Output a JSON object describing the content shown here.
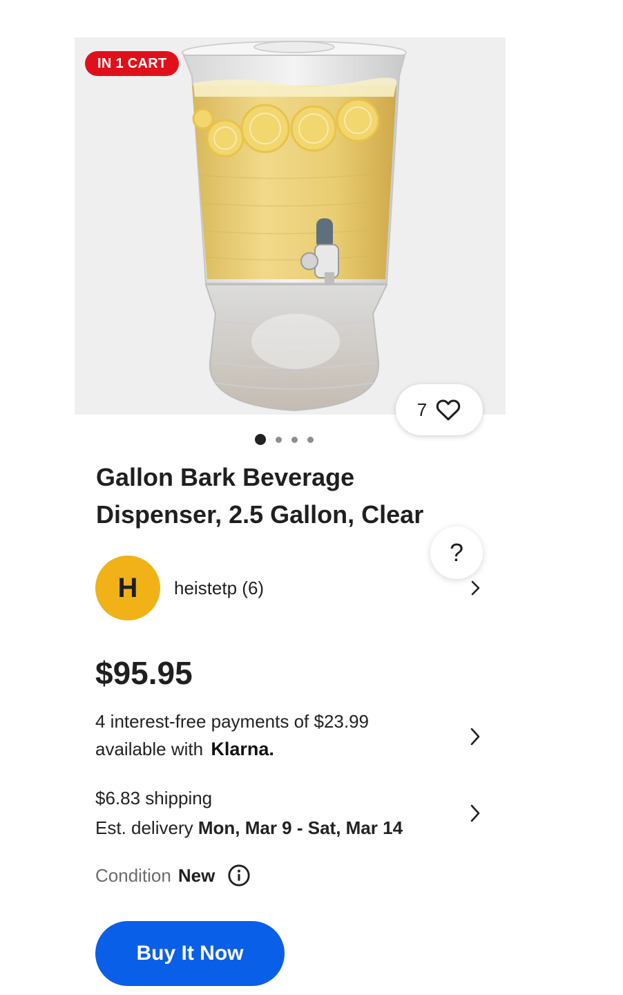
{
  "listing": {
    "cart_badge": "IN 1 CART",
    "watch_count": "7",
    "image_pager": {
      "total": 4,
      "active": 1
    },
    "title": "Gallon Bark Beverage Dispenser, 2.5 Gallon, Clear",
    "help": "?"
  },
  "seller": {
    "avatar_letter": "H",
    "name": "heistetp (6)"
  },
  "pricing": {
    "price": "$95.95",
    "klarna_line1": "4 interest-free payments of $23.99",
    "klarna_line2_prefix": "available with",
    "klarna_brand": "Klarna."
  },
  "shipping": {
    "cost": "$6.83 shipping",
    "est_prefix": "Est. delivery",
    "est_range": "Mon, Mar 9 - Sat, Mar 14"
  },
  "condition": {
    "label": "Condition",
    "value": "New"
  },
  "actions": {
    "buy_now": "Buy It Now"
  },
  "icons": {
    "heart": "heart-outline-icon",
    "chevron": "chevron-right-icon",
    "info": "info-circle-icon"
  },
  "colors": {
    "cart_badge_bg": "#e0101b",
    "avatar_bg": "#f0b217",
    "buy_button_bg": "#0a5fe8"
  }
}
